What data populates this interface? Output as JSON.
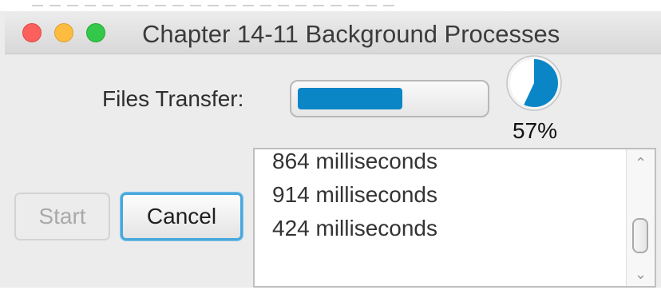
{
  "window": {
    "title": "Chapter 14-11 Background Processes"
  },
  "transfer": {
    "label": "Files Transfer:",
    "progress": 0.57,
    "percent_text": "57%",
    "accent_color": "#0a86c6"
  },
  "buttons": {
    "start_label": "Start",
    "start_enabled": false,
    "cancel_label": "Cancel"
  },
  "log": {
    "lines": [
      "864 milliseconds",
      "914 milliseconds",
      "424 milliseconds"
    ]
  },
  "icons": {
    "scroll_up": "chevron-up-icon",
    "scroll_down": "chevron-down-icon"
  },
  "colors": {
    "close": "#fc605c",
    "minimize": "#fdbc40",
    "maximize": "#34c84a"
  }
}
